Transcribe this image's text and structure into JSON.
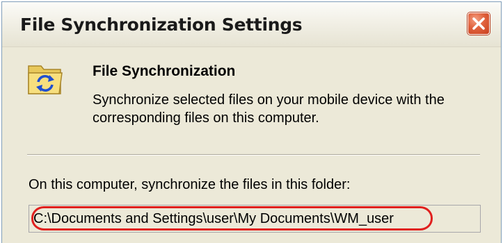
{
  "window": {
    "title": "File Synchronization Settings"
  },
  "titlebar": {
    "close_icon": "close-icon",
    "close_color": "#e0623e"
  },
  "header": {
    "icon": "sync-folder-icon",
    "title": "File Synchronization",
    "description": "Synchronize selected files on your mobile device with the corresponding files on this computer."
  },
  "folder": {
    "label": "On this computer, synchronize the files in this folder:",
    "path": "C:\\Documents and Settings\\user\\My Documents\\WM_user"
  },
  "annotation": {
    "highlight_color": "#e0201e"
  }
}
